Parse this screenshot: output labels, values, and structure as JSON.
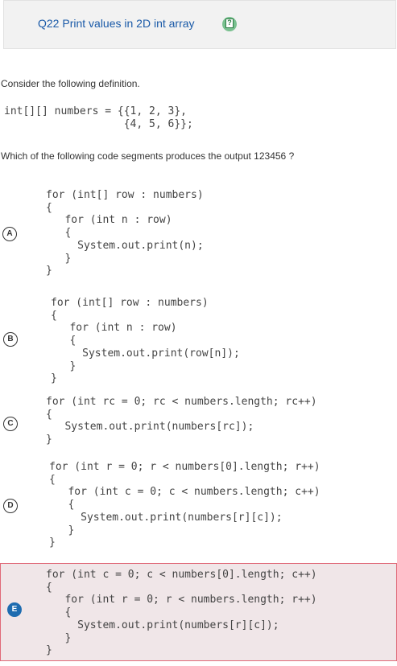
{
  "question": {
    "title": "Q22 Print values in 2D int array"
  },
  "prompt1": "Consider the following definition.",
  "definition": "int[][] numbers = {{1, 2, 3},\n                   {4, 5, 6}};",
  "prompt2": "Which of the following code segments produces the output 123456 ?",
  "options": [
    {
      "letter": "A",
      "code": "for (int[] row : numbers)\n{\n   for (int n : row)\n   {\n     System.out.print(n);\n   }\n}"
    },
    {
      "letter": "B",
      "code": "for (int[] row : numbers)\n{\n   for (int n : row)\n   {\n     System.out.print(row[n]);\n   }\n}"
    },
    {
      "letter": "C",
      "code": "for (int rc = 0; rc < numbers.length; rc++)\n{\n   System.out.print(numbers[rc]);\n}"
    },
    {
      "letter": "D",
      "code": "for (int r = 0; r < numbers[0].length; r++)\n{\n   for (int c = 0; c < numbers.length; c++)\n   {\n     System.out.print(numbers[r][c]);\n   }\n}"
    },
    {
      "letter": "E",
      "code": "for (int c = 0; c < numbers[0].length; c++)\n{\n   for (int r = 0; r < numbers.length; r++)\n   {\n     System.out.print(numbers[r][c]);\n   }\n}"
    }
  ],
  "selected_option": "E",
  "colors": {
    "title": "#1a5aa8",
    "selected_badge": "#1e6cb0",
    "selected_border": "#e06a79",
    "help_icon": "#79c08f"
  }
}
